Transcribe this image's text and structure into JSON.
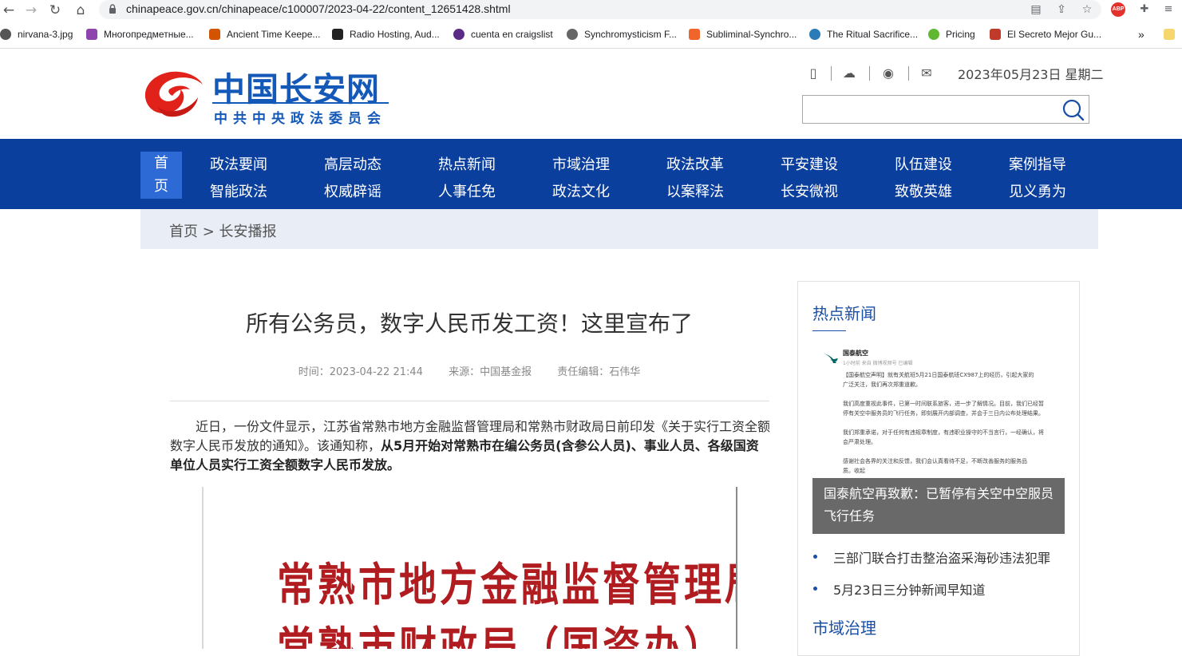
{
  "browser": {
    "url": "chinapeace.gov.cn/chinapeace/c100007/2023-04-22/content_12651428.shtml",
    "back_icon": "back-arrow-icon",
    "forward_icon": "forward-arrow-icon",
    "reload_icon": "reload-icon",
    "home_icon": "home-icon",
    "abp_label": "ABP",
    "bookmarks": [
      {
        "label": "nirvana-3.jpg",
        "color": "#555555"
      },
      {
        "label": "Многопредметные...",
        "color": "#8e44ad"
      },
      {
        "label": "Ancient Time Keepe...",
        "color": "#d35400"
      },
      {
        "label": "Radio Hosting, Aud...",
        "color": "#222222"
      },
      {
        "label": "cuenta en craigslist",
        "color": "#5b2c86"
      },
      {
        "label": "Synchromysticism F...",
        "color": "#666666"
      },
      {
        "label": "Subliminal-Synchro...",
        "color": "#f06529"
      },
      {
        "label": "The Ritual Sacrifice...",
        "color": "#2b7bb9"
      },
      {
        "label": "Pricing",
        "color": "#5fb830"
      },
      {
        "label": "El Secreto Mejor Gu...",
        "color": "#c0392b"
      }
    ],
    "overflow_label": "»"
  },
  "site": {
    "logo_title": "中国长安网",
    "logo_sub": "中共中央政法委员会",
    "date": "2023年05月23日 星期二",
    "search_placeholder": "",
    "brand_color": "#0b3f9e",
    "logo_red": "#e0221b"
  },
  "nav": {
    "home_top": "首",
    "home_bottom": "页",
    "row1": [
      "政法要闻",
      "高层动态",
      "热点新闻",
      "市域治理",
      "政法改革",
      "平安建设",
      "队伍建设",
      "案例指导"
    ],
    "row2": [
      "智能政法",
      "权威辟谣",
      "人事任免",
      "政法文化",
      "以案释法",
      "长安微视",
      "致敬英雄",
      "见义勇为"
    ]
  },
  "breadcrumb": "首页 > 长安播报",
  "article": {
    "title": "所有公务员，数字人民币发工资！这里宣布了",
    "time": "时间：2023-04-22 21:44",
    "source": "来源：中国基金报",
    "editor": "责任编辑：石伟华",
    "para_lead": "近日，一份文件显示，江苏省常熟市地方金融监督管理局和常熟市财政局日前印发《关于实行工资全额数字人民币发放的通知》。该通知称，",
    "para_bold": "从5月开始对常熟市在编公务员(含参公人员)、事业人员、各级国资单位人员实行工资全额数字人民币发放。",
    "doc_line1": "常熟市地方金融监督管理局",
    "doc_line2": "常熟市财政局（国资办）"
  },
  "sidebar": {
    "hot_heading": "热点新闻",
    "post": {
      "account": "国泰航空",
      "meta": "1小时前 来自 微博视频号 已编辑",
      "lines": [
        "【国泰航空声明】就有关航班5月21日国泰航班CX987上的经历，引起大家的",
        "广泛关注，我们再次郑重道歉。",
        "",
        "我们高度重视此事件，已第一时间联系旅客，进一步了解情况。目前，我们已经暂",
        "停有关空中服务员的飞行任务，即刻展开内部调查，并会于三日内公布处理结果。",
        "",
        "我们郑重承诺，对于任何有违规章制度，有违职业操守的不当言行，一经确认，将",
        "会严肃处理。",
        "",
        "感谢社会各界的关注和反馈，我们会认真看待不足，不断改善服务的服务品",
        "质。收起"
      ],
      "caption": "国泰航空再致歉：已暂停有关空中空服员飞行任务"
    },
    "hot_items": [
      "三部门联合打击整治盗采海砂违法犯罪",
      "5月23日三分钟新闻早知道"
    ],
    "city_heading": "市域治理"
  }
}
